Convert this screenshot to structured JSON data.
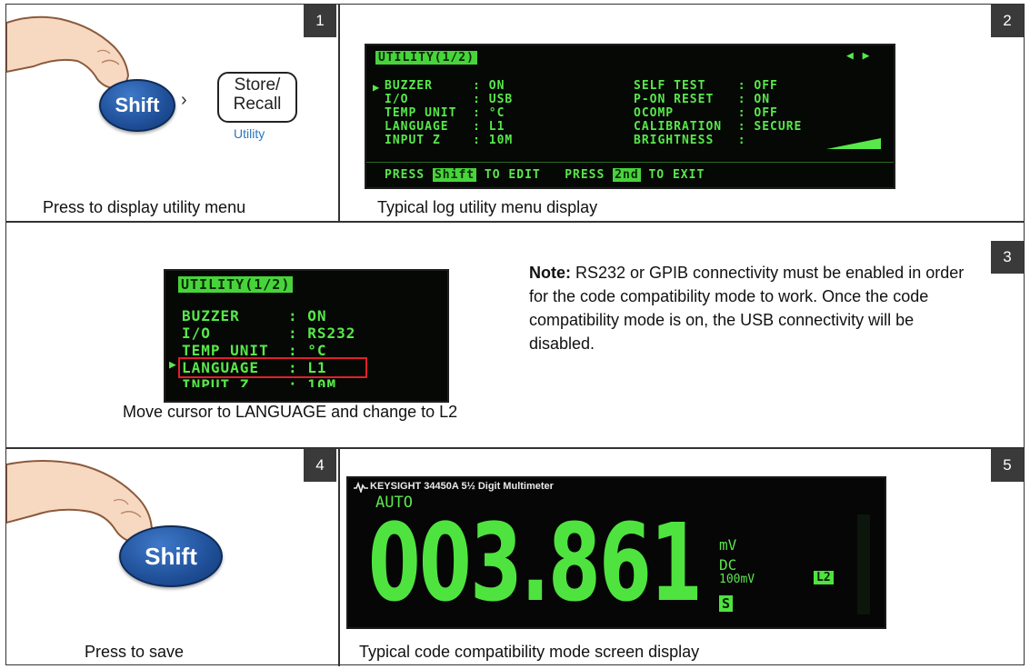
{
  "panels": {
    "p1": {
      "number": "1",
      "caption": "Press to display utility menu",
      "shift_label": "Shift",
      "chevron": "›",
      "store_label_1": "Store/",
      "store_label_2": "Recall",
      "utility_label": "Utility"
    },
    "p2": {
      "number": "2",
      "caption": "Typical log utility menu display"
    },
    "p3": {
      "number": "3",
      "caption": "Move cursor to LANGUAGE and change to L2",
      "note_bold": "Note:",
      "note_text": " RS232 or GPIB connectivity must be enabled in order for the code compatibility mode to work. Once the code compatibility mode is on, the USB connectivity will be disabled."
    },
    "p4": {
      "number": "4",
      "caption": "Press to save",
      "shift_label": "Shift"
    },
    "p5": {
      "number": "5",
      "caption": "Typical code compatibility mode screen display"
    }
  },
  "utility_screen": {
    "header": "UTILITY(1/2)",
    "arrows": "◀ ▶",
    "left_rows": [
      "BUZZER     : ON",
      "I/O        : USB",
      "TEMP UNIT  : °C",
      "LANGUAGE   : L1",
      "INPUT Z    : 10M"
    ],
    "right_rows": [
      "SELF TEST    : OFF",
      "P-ON RESET   : ON",
      "OCOMP        : OFF",
      "CALIBRATION  : SECURE",
      "BRIGHTNESS   :"
    ],
    "footer_1": "PRESS ",
    "footer_shift": "Shift",
    "footer_2": " TO EDIT   PRESS ",
    "footer_2nd": "2nd",
    "footer_3": " TO EXIT"
  },
  "language_screen": {
    "header": "UTILITY(1/2)",
    "rows": [
      "BUZZER     : ON",
      "I/O        : RS232",
      "TEMP UNIT  : °C",
      "LANGUAGE   : L1",
      "INPUT Z    : 10M"
    ]
  },
  "dmm_screen": {
    "brand": "KEYSIGHT  34450A  5½ Digit Multimeter",
    "range_mode": "AUTO",
    "reading": "003.861",
    "unit": "mV",
    "function": "DC",
    "range": "100mV",
    "language_tag": "L2",
    "s_tag": "S"
  },
  "colors": {
    "lcd_green": "#58e84a",
    "key_blue": "#1f4f98",
    "highlight_red": "#e0202b"
  }
}
